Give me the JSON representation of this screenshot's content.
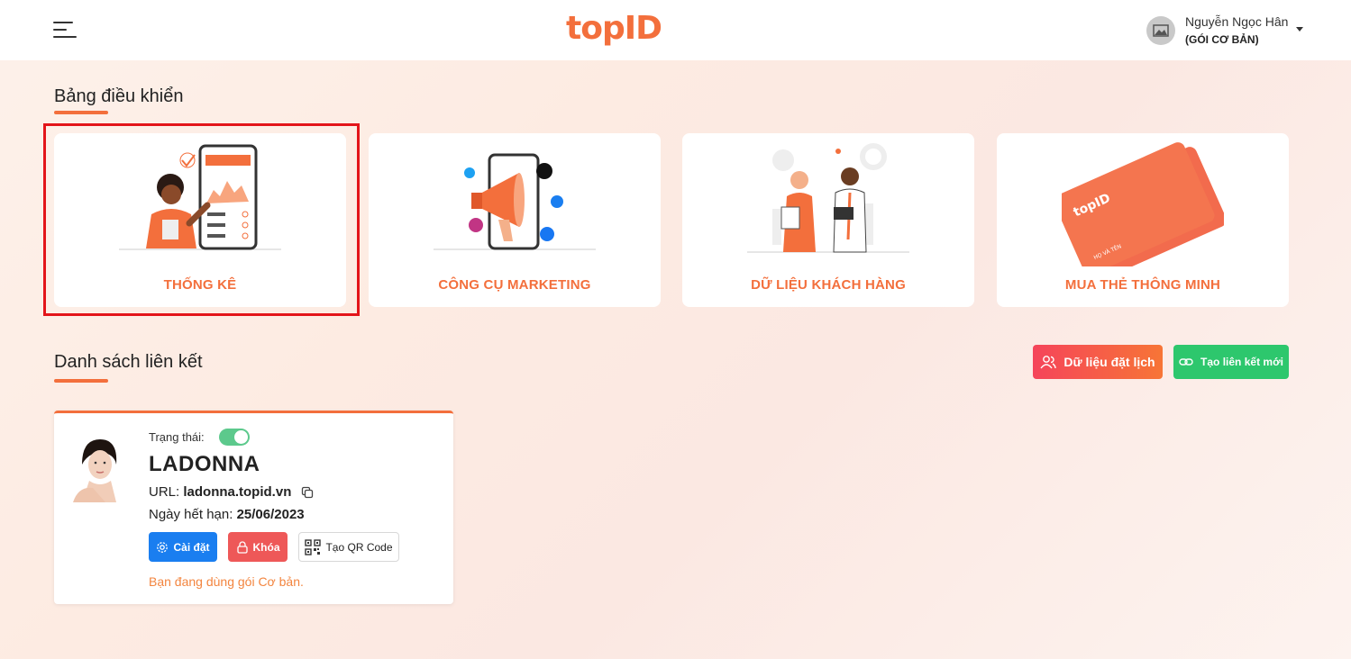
{
  "header": {
    "logo_text": "topID",
    "user_name": "Nguyễn Ngọc Hân",
    "user_plan": "(GÓI CƠ BẢN)"
  },
  "dashboard": {
    "title": "Bảng điều khiển",
    "cards": [
      {
        "label": "THỐNG KÊ",
        "icon": "statistics-illustration"
      },
      {
        "label": "CÔNG CỤ MARKETING",
        "icon": "marketing-illustration"
      },
      {
        "label": "DỮ LIỆU KHÁCH HÀNG",
        "icon": "customer-data-illustration"
      },
      {
        "label": "MUA THẺ THÔNG MINH",
        "icon": "smart-card-illustration"
      }
    ]
  },
  "links": {
    "title": "Danh sách liên kết",
    "booking_button": "Dữ liệu đặt lịch",
    "new_link_button": "Tạo liên kết mới",
    "item": {
      "status_label": "Trạng thái:",
      "status_on": true,
      "name": "LADONNA",
      "url_label": "URL:",
      "url": "ladonna.topid.vn",
      "expiry_label": "Ngày hết hạn:",
      "expiry": "25/06/2023",
      "settings_button": "Cài đặt",
      "lock_button": "Khóa",
      "qr_button": "Tạo QR Code",
      "plan_note": "Bạn đang dùng gói Cơ bản."
    }
  },
  "colors": {
    "accent": "#f36f3c",
    "success": "#2dc76d",
    "primary": "#1a7ef0",
    "danger": "#ee5858",
    "highlight_border": "#e3151a"
  }
}
